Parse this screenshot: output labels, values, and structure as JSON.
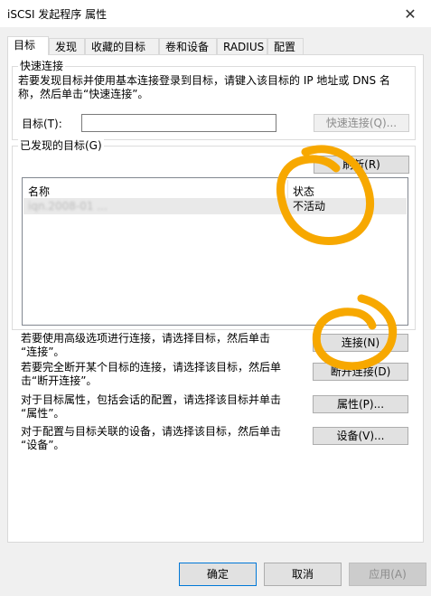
{
  "window": {
    "title": "iSCSI 发起程序 属性"
  },
  "tabs": [
    "目标",
    "发现",
    "收藏的目标",
    "卷和设备",
    "RADIUS",
    "配置"
  ],
  "quick_connect": {
    "group_label": "快速连接",
    "description_line1": "若要发现目标并使用基本连接登录到目标，请键入该目标的 IP 地址或 DNS 名",
    "description_line2": "称，然后单击“快速连接”。",
    "target_label": "目标(T):",
    "target_value": "",
    "button": "快速连接(Q)..."
  },
  "discovered": {
    "group_label": "已发现的目标(G)",
    "refresh_button": "刷新(R)",
    "columns": [
      "名称",
      "状态"
    ],
    "rows": [
      {
        "name": "iqn.2008-01 ...",
        "status": "不活动"
      }
    ]
  },
  "actions": [
    {
      "line1": "若要使用高级选项进行连接，请选择目标，然后单击",
      "line2": "“连接”。",
      "button": "连接(N)"
    },
    {
      "line1": "若要完全断开某个目标的连接，请选择该目标，然后单",
      "line2": "击“断开连接”。",
      "button": "断开连接(D)"
    },
    {
      "line1": "对于目标属性，包括会话的配置，请选择该目标并单击",
      "line2": "“属性”。",
      "button": "属性(P)..."
    },
    {
      "line1": "对于配置与目标关联的设备，请选择该目标，然后单击",
      "line2": "“设备”。",
      "button": "设备(V)..."
    }
  ],
  "footer": {
    "ok": "确定",
    "cancel": "取消",
    "apply": "应用(A)"
  },
  "colors": {
    "annotation": "#f7a800",
    "selection_row": "#e9e9e9",
    "accent": "#0078d7"
  }
}
